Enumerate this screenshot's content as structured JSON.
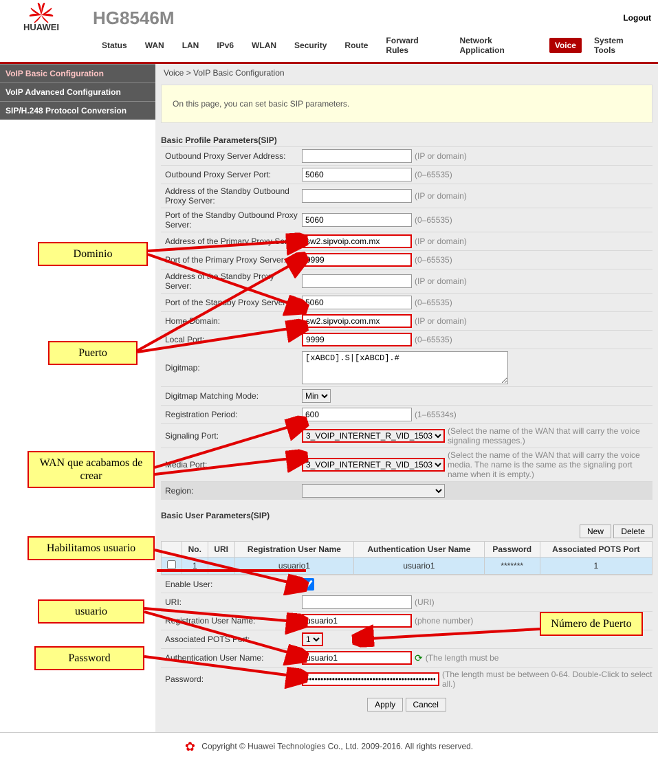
{
  "header": {
    "model": "HG8546M",
    "logout": "Logout",
    "brand": "HUAWEI"
  },
  "nav": [
    "Status",
    "WAN",
    "LAN",
    "IPv6",
    "WLAN",
    "Security",
    "Route",
    "Forward Rules",
    "Network Application",
    "Voice",
    "System Tools"
  ],
  "nav_active": 9,
  "sidebar": {
    "items": [
      "VoIP Basic Configuration",
      "VoIP Advanced Configuration",
      "SIP/H.248 Protocol Conversion"
    ],
    "active": 0
  },
  "breadcrumb": "Voice > VoIP Basic Configuration",
  "info": "On this page, you can set basic SIP parameters.",
  "section1_title": "Basic Profile Parameters(SIP)",
  "rows": {
    "r1": {
      "label": "Outbound Proxy Server Address:",
      "val": "",
      "hint": "(IP or domain)"
    },
    "r2": {
      "label": "Outbound Proxy Server Port:",
      "val": "5060",
      "hint": "(0–65535)"
    },
    "r3": {
      "label": "Address of the Standby Outbound Proxy Server:",
      "val": "",
      "hint": "(IP or domain)"
    },
    "r4": {
      "label": "Port of the Standby Outbound Proxy Server:",
      "val": "5060",
      "hint": "(0–65535)"
    },
    "r5": {
      "label": "Address of the Primary Proxy Server:",
      "val": "sw2.sipvoip.com.mx",
      "hint": "(IP or domain)"
    },
    "r6": {
      "label": "Port of the Primary Proxy Server:",
      "val": "9999",
      "hint": "(0–65535)"
    },
    "r7": {
      "label": "Address of the Standby Proxy Server:",
      "val": "",
      "hint": "(IP or domain)"
    },
    "r8": {
      "label": "Port of the Standby Proxy Server:",
      "val": "5060",
      "hint": "(0–65535)"
    },
    "r9": {
      "label": "Home Domain:",
      "val": "sw2.sipvoip.com.mx",
      "hint": "(IP or domain)"
    },
    "r10": {
      "label": "Local Port:",
      "val": "9999",
      "hint": "(0–65535)"
    },
    "r11": {
      "label": "Digitmap:",
      "val": "[xABCD].S|[xABCD].#"
    },
    "r12": {
      "label": "Digitmap Matching Mode:",
      "val": "Min"
    },
    "r13": {
      "label": "Registration Period:",
      "val": "600",
      "hint": "(1–65534s)"
    },
    "r14": {
      "label": "Signaling Port:",
      "val": "3_VOIP_INTERNET_R_VID_1503",
      "hint": "(Select the name of the WAN that will carry the voice signaling messages.)"
    },
    "r15": {
      "label": "Media Port:",
      "val": "3_VOIP_INTERNET_R_VID_1503",
      "hint": "(Select the name of the WAN that will carry the voice media. The name is the same as the signaling port name when it is empty.)"
    },
    "r16": {
      "label": "Region:",
      "val": ""
    }
  },
  "section2_title": "Basic User Parameters(SIP)",
  "buttons": {
    "new": "New",
    "delete": "Delete",
    "apply": "Apply",
    "cancel": "Cancel"
  },
  "table": {
    "headers": [
      "",
      "No.",
      "URI",
      "Registration User Name",
      "Authentication User Name",
      "Password",
      "Associated POTS Port"
    ],
    "row": {
      "no": "1",
      "uri": "--",
      "reg": "usuario1",
      "auth": "usuario1",
      "pwd": "*******",
      "pots": "1"
    }
  },
  "urows": {
    "u1": {
      "label": "Enable User:"
    },
    "u2": {
      "label": "URI:",
      "val": "",
      "hint": "(URI)"
    },
    "u3": {
      "label": "Registration User Name:",
      "val": "usuario1",
      "hint": "(phone number)"
    },
    "u4": {
      "label": "Associated POTS Port:",
      "val": "1"
    },
    "u5": {
      "label": "Authentication User Name:",
      "val": "usuario1",
      "hint": "(The length must be"
    },
    "u6": {
      "label": "Password:",
      "val": "••••••••••••••••••••••••••••••••••••••••••••••",
      "hint": "(The length must be between 0-64. Double-Click to select all.)"
    }
  },
  "footer": "Copyright © Huawei Technologies Co., Ltd. 2009-2016. All rights reserved.",
  "annots": {
    "a1": "Dominio",
    "a2": "Puerto",
    "a3": "WAN que acabamos de crear",
    "a4": "Habilitamos usuario",
    "a5": "usuario",
    "a6": "Password",
    "a7": "Número de Puerto"
  }
}
